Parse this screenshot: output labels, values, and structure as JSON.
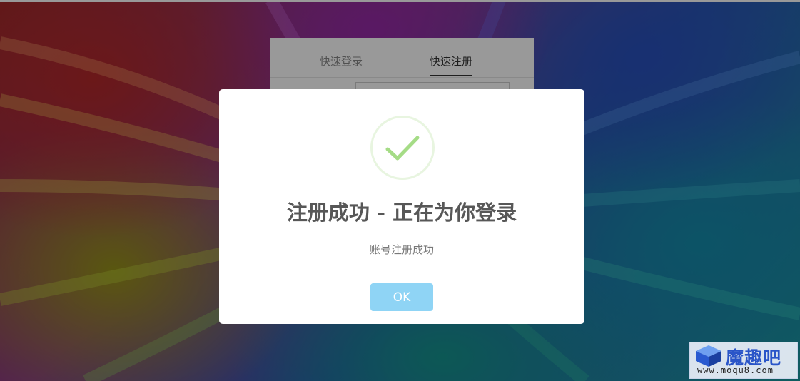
{
  "background_form": {
    "tabs": [
      {
        "label": "快速登录",
        "active": false
      },
      {
        "label": "快速注册",
        "active": true
      }
    ]
  },
  "alert": {
    "icon": "success-check-icon",
    "title": "注册成功 - 正在为你登录",
    "text": "账号注册成功",
    "confirm_label": "OK",
    "confirm_color": "#8fd4f5",
    "icon_color": "#a5dc86"
  },
  "watermark": {
    "brand": "魔趣吧",
    "url": "www.moqu8.com"
  }
}
